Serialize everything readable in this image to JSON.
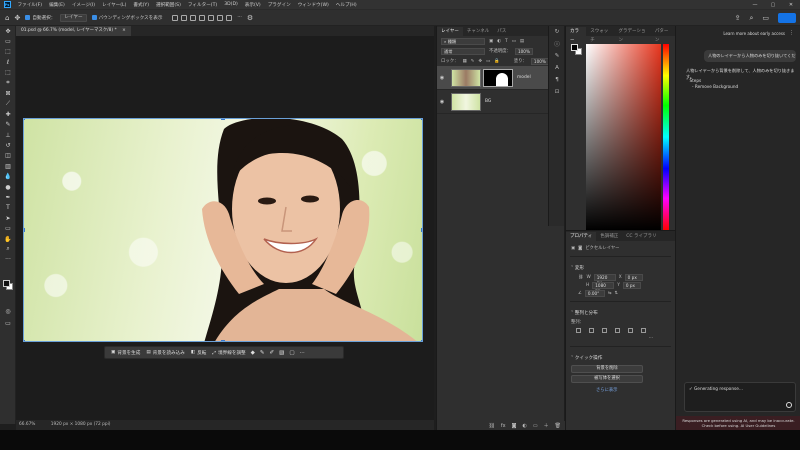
{
  "menubar": {
    "logo": "Ps",
    "items": [
      "ファイル(F)",
      "編集(E)",
      "イメージ(I)",
      "レイヤー(L)",
      "書式(Y)",
      "選択範囲(S)",
      "フィルター(T)",
      "3D(D)",
      "表示(V)",
      "プラグイン",
      "ウィンドウ(W)",
      "ヘルプ(H)"
    ],
    "window_controls": [
      "—",
      "▢",
      "✕"
    ]
  },
  "options": {
    "auto_select_label": "自動選択：",
    "auto_select_value": "レイヤー",
    "bounding_box_label": "バウンディングボックスを表示"
  },
  "document": {
    "tab_title": "01.psd @ 66.7% (model, レイヤーマスク/8) *",
    "tab_close": "×"
  },
  "contextual_bar": {
    "generate_bg": "背景を生成",
    "import_bg": "背景を読み込み",
    "invert": "反転",
    "refine_edge": "境界線を調整",
    "more": "···"
  },
  "status": {
    "zoom": "66.67%",
    "doc_size": "1920 px × 1080 px (72 ppi)"
  },
  "layers_panel": {
    "tabs": [
      "レイヤー",
      "チャンネル",
      "パス"
    ],
    "filter_label": "種類",
    "blend_mode": "通常",
    "opacity_label": "不透明度：",
    "opacity_value": "100%",
    "lock_label": "ロック：",
    "fill_label": "塗り：",
    "fill_value": "100%",
    "layers": [
      {
        "name": "model",
        "selected": true,
        "has_mask": true
      },
      {
        "name": "BG",
        "selected": false,
        "has_mask": false
      }
    ],
    "footer_icons": [
      "link-icon",
      "fx-icon",
      "mask-icon",
      "adjust-icon",
      "folder-icon",
      "add-icon",
      "trash-icon"
    ]
  },
  "color_panel": {
    "tabs": [
      "カラー",
      "スウォッチ",
      "グラデーション",
      "パターン"
    ]
  },
  "properties_panel": {
    "tabs": [
      "プロパティ",
      "色調補正",
      "CC ライブラリ"
    ],
    "layer_type": "ピクセルレイヤー",
    "transform_title": "変形",
    "w_label": "W",
    "w_value": "1920 px",
    "x_label": "X",
    "x_value": "0 px",
    "h_label": "H",
    "h_value": "1080 px",
    "y_label": "Y",
    "y_value": "0 px",
    "angle_value": "0.00°",
    "align_title": "整列と分布",
    "align_label": "整列：",
    "quick_actions_title": "クイック操作",
    "remove_bg_button": "背景を削除",
    "select_subject_button": "被写体を選択",
    "show_more": "さらに表示"
  },
  "assistant": {
    "early_access_link": "Learn more about early access",
    "user_prompt": "人物のレイヤーから人物のみを切り抜いてください。",
    "reply": "人物レイヤーから背景を削除して、人物のみを切り抜きます。",
    "steps_label": "Steps",
    "steps": [
      "Remove Background"
    ],
    "generating_text": "Generating response...",
    "disclaimer": "Responses are generated using AI, and may be inaccurate. Check before using. AI User Guidelines"
  }
}
